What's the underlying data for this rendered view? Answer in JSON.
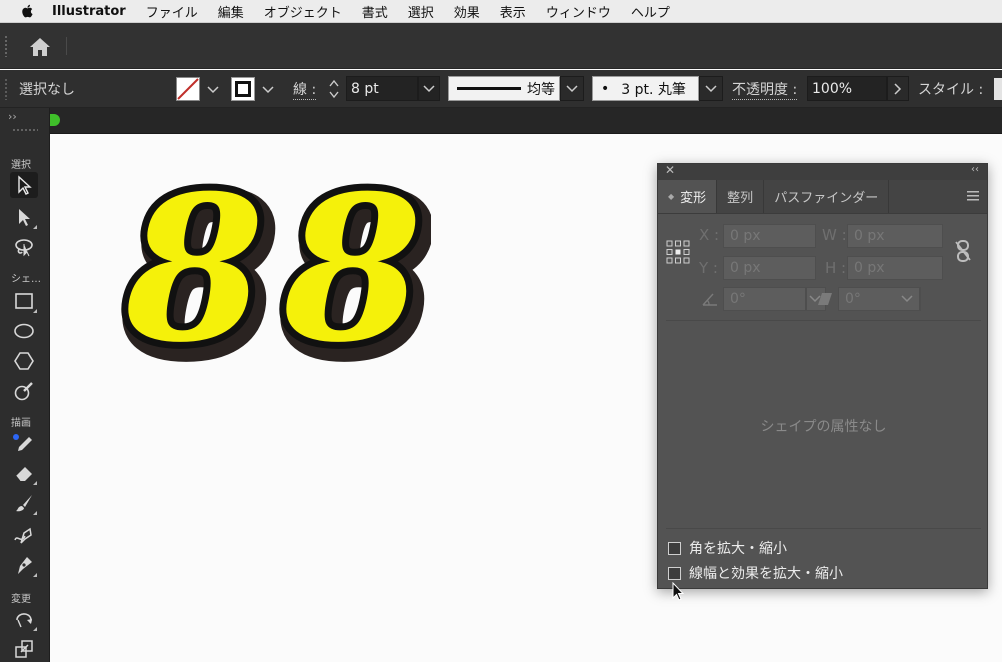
{
  "menubar": {
    "app_name": "Illustrator",
    "items": [
      "ファイル",
      "編集",
      "オブジェクト",
      "書式",
      "選択",
      "効果",
      "表示",
      "ウィンドウ",
      "ヘルプ"
    ]
  },
  "control": {
    "selection_status": "選択なし",
    "stroke_label": "線 :",
    "stroke_weight": "8 pt",
    "stroke_profile_label": "均等",
    "brush_label": "3 pt. 丸筆",
    "brush_bullet": "•",
    "opacity_label": "不透明度 :",
    "opacity_value": "100%",
    "style_label": "スタイル :"
  },
  "toolbar": {
    "sections": {
      "select": "選択",
      "shape": "シェ…",
      "draw": "描画",
      "modify": "変更"
    },
    "expand_icon": "››"
  },
  "artwork": {
    "glyphs": [
      "8",
      "8"
    ],
    "fill_color": "#f5f10a",
    "outline_color": "#111111",
    "shadow_color": "#2a2321"
  },
  "panel": {
    "close_glyph": "✕",
    "collapse_glyph": "‹‹",
    "tabs": [
      "変形",
      "整列",
      "パスファインダー"
    ],
    "active_tab": "変形",
    "x_label": "X :",
    "y_label": "Y :",
    "w_label": "W :",
    "h_label": "H :",
    "x_value": "0 px",
    "y_value": "0 px",
    "w_value": "0 px",
    "h_value": "0 px",
    "angle_value": "0°",
    "shear_value": "0°",
    "no_shape_text": "シェイプの属性なし",
    "scale_corners_label": "角を拡大・縮小",
    "scale_strokes_label": "線幅と効果を拡大・縮小"
  },
  "colors": {
    "ui_dark": "#323232",
    "panel_bg": "#535353",
    "document_green": "#3fbf2a",
    "accent_blue": "#2d66f5"
  }
}
